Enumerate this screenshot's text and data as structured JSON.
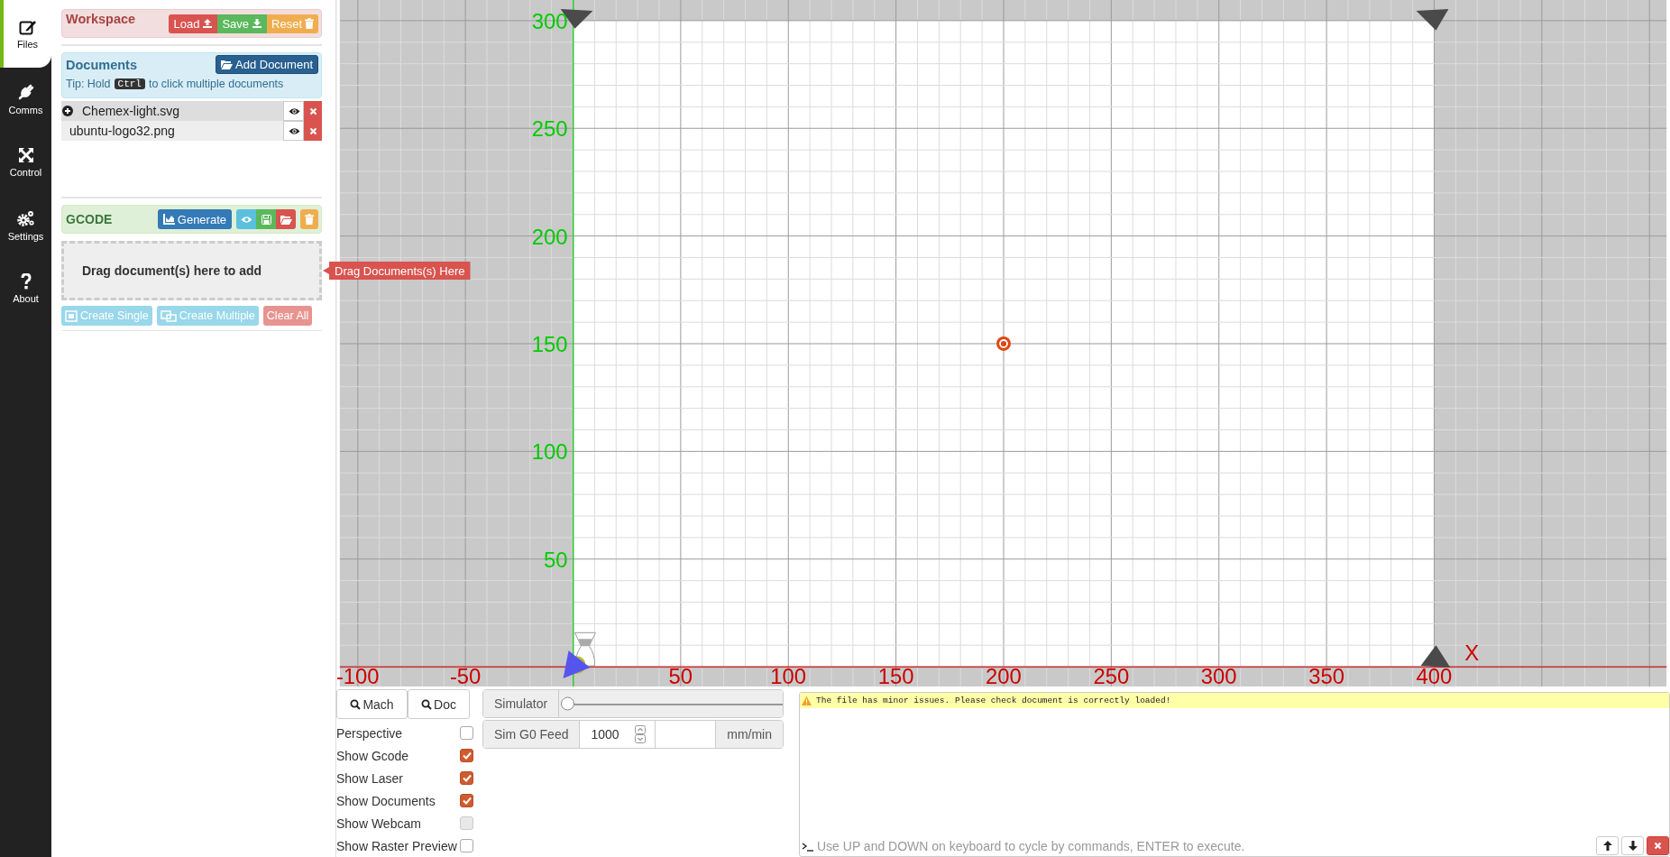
{
  "nav": [
    {
      "label": "Files",
      "kind": "files",
      "selected": true
    },
    {
      "label": "Comms",
      "kind": "comms",
      "selected": false
    },
    {
      "label": "Control",
      "kind": "control",
      "selected": false
    },
    {
      "label": "Settings",
      "kind": "settings",
      "selected": false
    },
    {
      "label": "About",
      "kind": "about",
      "selected": false
    }
  ],
  "workspace": {
    "title": "Workspace",
    "buttons": [
      {
        "label": "Load",
        "kind": "load"
      },
      {
        "label": "Save",
        "kind": "save"
      },
      {
        "label": "Reset",
        "kind": "reset"
      }
    ]
  },
  "documents": {
    "title": "Documents",
    "add_button": "Add Document",
    "tip_before": "Tip: Hold",
    "tip_key": "Ctrl",
    "tip_after": "to click multiple documents",
    "items": [
      {
        "name": "Chemex-light.svg",
        "expandable": true
      },
      {
        "name": "ubuntu-logo32.png",
        "expandable": false
      }
    ]
  },
  "gcode": {
    "title": "GCODE",
    "generate": "Generate",
    "actions": [
      {
        "kind": "view"
      },
      {
        "kind": "save"
      },
      {
        "kind": "open"
      },
      {
        "kind": "delete"
      }
    ],
    "dropzone": "Drag document(s) here to add",
    "buttons": [
      {
        "label": "Create Single",
        "kind": "single",
        "disabled": true
      },
      {
        "label": "Create Multiple",
        "kind": "multiple",
        "disabled": true
      },
      {
        "label": "Clear All",
        "kind": "clear",
        "disabled": true
      }
    ]
  },
  "drag_hint": "Drag Documents(s) Here",
  "viewer": {
    "x_labels_negative": [
      "-100",
      "-50"
    ],
    "x_labels_positive": [
      "50",
      "100",
      "150",
      "200",
      "250",
      "300",
      "350",
      "400"
    ],
    "y_labels": [
      "300",
      "250",
      "200",
      "150",
      "100",
      "50"
    ],
    "x_axis": "X"
  },
  "view_buttons": [
    "Mach",
    "Doc"
  ],
  "options": [
    {
      "label": "Perspective",
      "checked": false,
      "disabled": false
    },
    {
      "label": "Show Gcode",
      "checked": true,
      "disabled": false
    },
    {
      "label": "Show Laser",
      "checked": true,
      "disabled": false
    },
    {
      "label": "Show Documents",
      "checked": true,
      "disabled": false
    },
    {
      "label": "Show Webcam",
      "checked": false,
      "disabled": true
    },
    {
      "label": "Show Raster Preview",
      "checked": false,
      "disabled": false
    }
  ],
  "simulator": {
    "label": "Simulator",
    "level": 0
  },
  "feed": {
    "label": "Sim G0 Feed",
    "value": "1000",
    "unit": "mm/min"
  },
  "console": {
    "messages": [
      {
        "kind": "warning",
        "text": "The file has minor issues. Please check document is correctly loaded!"
      }
    ],
    "placeholder": "Use UP and DOWN on keyboard to cycle by commands, ENTER to execute."
  }
}
